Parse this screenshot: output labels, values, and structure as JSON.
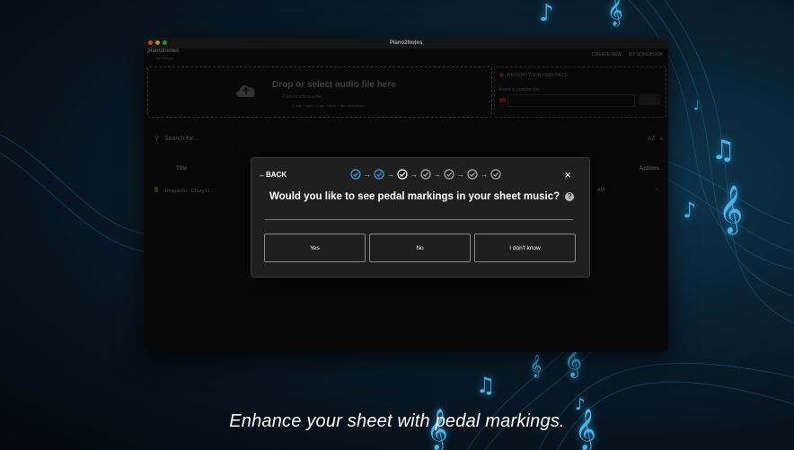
{
  "window": {
    "title": "Piano2Notes",
    "traffic_colors": [
      "#ff5f57",
      "#febc2e",
      "#28c840"
    ]
  },
  "app": {
    "logo": "piano2notes",
    "logo_sub": "by Klangio",
    "header_links": [
      "CREATE NEW",
      "MY SONGBOOK"
    ],
    "drop_title": "Drop or select audio file here",
    "drop_sub": "Click to select a file",
    "drop_formats": "(*.wav, *.mp3, *.mp4, *.m4a, *.flac, and more)",
    "record_label": "RECORD YOUR OWN PIECE",
    "youtube_label": "Insert a youtube link",
    "search_placeholder": "Search for...",
    "sort_label": "AZ",
    "col_title": "Title",
    "col_actions": "Actions",
    "row_title": "Despacito - Crazy Li...",
    "row_time": "AM",
    "row_more": "..."
  },
  "modal": {
    "back_label": "BACK",
    "close_label": "×",
    "steps_total": 7,
    "steps_done": 2,
    "current_step": 3,
    "question": "Would you like to see pedal markings in your sheet music?",
    "help_label": "?",
    "answers": [
      "Yes",
      "No",
      "I don't know"
    ],
    "accent_color": "#3aa0e8"
  },
  "caption": "Enhance your sheet with pedal markings."
}
